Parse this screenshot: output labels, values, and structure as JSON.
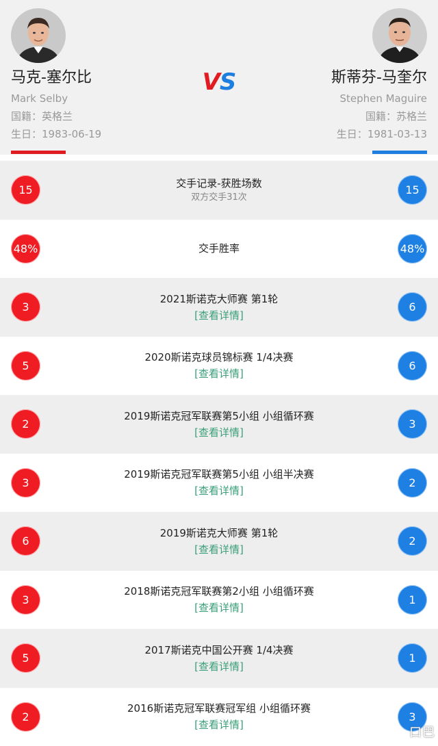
{
  "players": {
    "left": {
      "name_cn": "马克-塞尔比",
      "name_en": "Mark Selby",
      "nationality_label": "国籍：",
      "nationality": "英格兰",
      "birth_label": "生日：",
      "birth": "1983-06-19",
      "color": "#e11b22"
    },
    "right": {
      "name_cn": "斯蒂芬-马奎尔",
      "name_en": "Stephen Maguire",
      "nationality_label": "国籍：",
      "nationality": "苏格兰",
      "birth_label": "生日：",
      "birth": "1981-03-13",
      "color": "#1e7ee0"
    }
  },
  "vs": {
    "v": "V",
    "s": "S"
  },
  "rows": [
    {
      "left": "15",
      "title": "交手记录-获胜场数",
      "sub": "双方交手31次",
      "right": "15"
    },
    {
      "left": "48%",
      "title": "交手胜率",
      "right": "48%"
    },
    {
      "left": "3",
      "title": "2021斯诺克大师赛 第1轮",
      "link": "[查看详情]",
      "right": "6"
    },
    {
      "left": "5",
      "title": "2020斯诺克球员锦标赛 1/4决赛",
      "link": "[查看详情]",
      "right": "6"
    },
    {
      "left": "2",
      "title": "2019斯诺克冠军联赛第5小组 小组循环赛",
      "link": "[查看详情]",
      "right": "3"
    },
    {
      "left": "3",
      "title": "2019斯诺克冠军联赛第5小组 小组半决赛",
      "link": "[查看详情]",
      "right": "2"
    },
    {
      "left": "6",
      "title": "2019斯诺克大师赛 第1轮",
      "link": "[查看详情]",
      "right": "2"
    },
    {
      "left": "3",
      "title": "2018斯诺克冠军联赛第2小组 小组循环赛",
      "link": "[查看详情]",
      "right": "1"
    },
    {
      "left": "5",
      "title": "2017斯诺克中国公开赛 1/4决赛",
      "link": "[查看详情]",
      "right": "1"
    },
    {
      "left": "2",
      "title": "2016斯诺克冠军联赛冠军组 小组循环赛",
      "link": "[查看详情]",
      "right": "3"
    }
  ],
  "watermark": "口巴"
}
